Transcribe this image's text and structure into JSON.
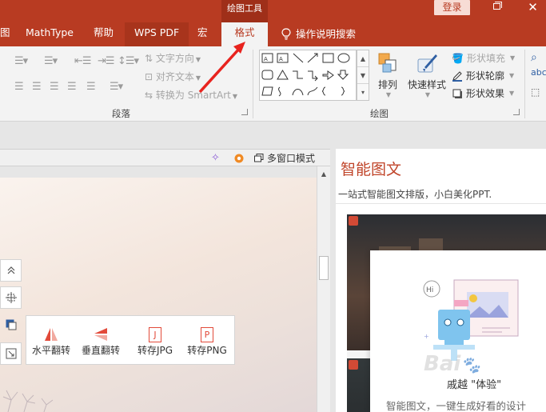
{
  "title_bar": {
    "context_group_title": "绘图工具",
    "login_label": "登录",
    "close_glyph": "✕"
  },
  "tabs": {
    "partial": "图",
    "mathtype": "MathType",
    "help": "帮助",
    "wps_pdf": "WPS PDF",
    "macro": "宏",
    "format": "格式",
    "search": "操作说明搜索"
  },
  "ribbon": {
    "text_direction": "文字方向",
    "align_text": "对齐文本",
    "convert_smartart": "转换为 SmartArt",
    "paragraph_group": "段落",
    "drawing_group": "绘图",
    "arrange": "排列",
    "quick_styles": "快速样式",
    "shape_fill": "形状填充",
    "shape_outline": "形状轮廓",
    "shape_effects": "形状效果",
    "find_partial": "abc"
  },
  "toolbar": {
    "multi_window": "多窗口模式"
  },
  "float_bar": {
    "flip_h": "水平翻转",
    "flip_v": "垂直翻转",
    "save_jpg": "转存JPG",
    "save_png": "转存PNG",
    "jpg_letter": "J",
    "png_letter": "P"
  },
  "right_panel": {
    "title": "智能图文",
    "subtitle": "一站式智能图文排版，小白美化PPT.",
    "popup_cta": "戚越 \"体验\"",
    "popup_desc": "智能图文，一键生成好看的设计"
  },
  "colors": {
    "accent": "#b83b22",
    "ribbon_bg": "#f3f3f3",
    "panel_title": "#c0452a"
  }
}
